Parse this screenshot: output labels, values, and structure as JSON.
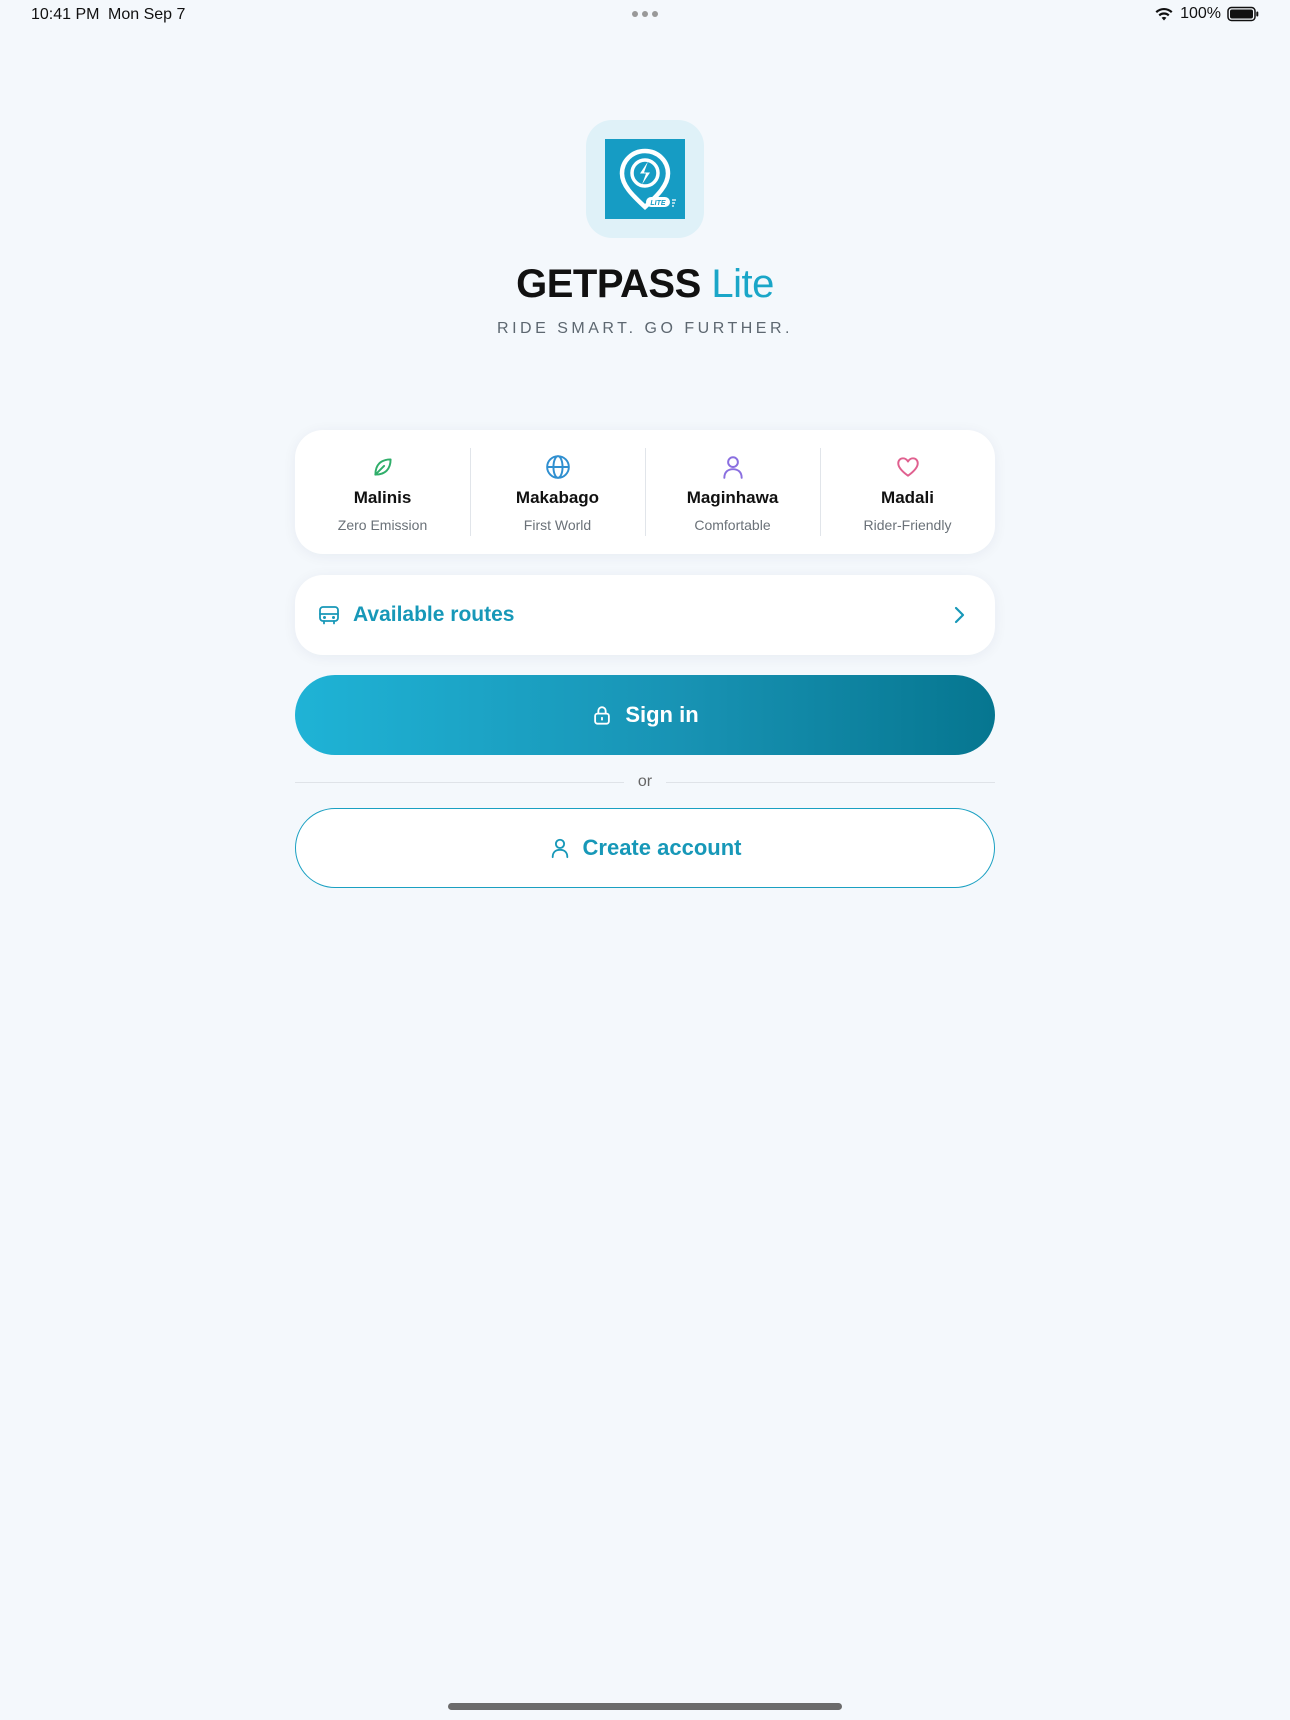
{
  "status_bar": {
    "time": "10:41 PM",
    "date": "Mon Sep 7",
    "battery": "100%"
  },
  "app": {
    "title_main": "GETPASS",
    "title_accent": "Lite",
    "tagline": "RIDE SMART. GO FURTHER.",
    "logo_icon": "getpass-lite-logo",
    "logo_badge": "LITE"
  },
  "features": [
    {
      "icon": "leaf-icon",
      "title": "Malinis",
      "subtitle": "Zero Emission",
      "color": "#2fae6a"
    },
    {
      "icon": "globe-icon",
      "title": "Makabago",
      "subtitle": "First World",
      "color": "#2f8fd0"
    },
    {
      "icon": "person-icon",
      "title": "Maginhawa",
      "subtitle": "Comfortable",
      "color": "#8a6fe0"
    },
    {
      "icon": "heart-icon",
      "title": "Madali",
      "subtitle": "Rider-Friendly",
      "color": "#e0608f"
    }
  ],
  "routes": {
    "label": "Available routes",
    "icon": "bus-icon"
  },
  "signin": {
    "label": "Sign in",
    "icon": "lock-icon"
  },
  "divider": {
    "text": "or"
  },
  "create_account": {
    "label": "Create account",
    "icon": "person-icon"
  },
  "colors": {
    "accent": "#1aa6c8",
    "background": "#f4f8fc"
  }
}
